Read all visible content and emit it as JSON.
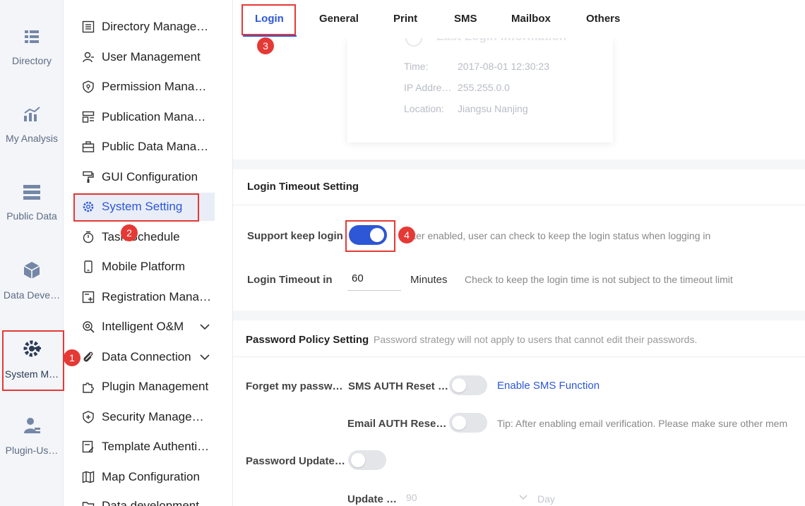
{
  "rail": [
    {
      "label": "Directory",
      "icon": "directory-icon"
    },
    {
      "label": "My Analysis",
      "icon": "analysis-chart-icon"
    },
    {
      "label": "Public Data",
      "icon": "public-data-icon"
    },
    {
      "label": "Data Deve…",
      "icon": "data-dev-cube-icon"
    },
    {
      "label": "System M…",
      "icon": "system-gear-icon",
      "active": true
    },
    {
      "label": "Plugin-Us…",
      "icon": "plugin-user-icon"
    }
  ],
  "menu": [
    {
      "label": "Directory Manage…",
      "icon": "list-icon"
    },
    {
      "label": "User Management",
      "icon": "user-icon"
    },
    {
      "label": "Permission Mana…",
      "icon": "shield-icon"
    },
    {
      "label": "Publication Mana…",
      "icon": "publication-icon"
    },
    {
      "label": "Public Data Mana…",
      "icon": "briefcase-icon"
    },
    {
      "label": "GUI Configuration",
      "icon": "paint-roller-icon"
    },
    {
      "label": "System Setting",
      "icon": "gear-icon",
      "active": true
    },
    {
      "label": "Task Schedule",
      "icon": "stopwatch-icon"
    },
    {
      "label": "Mobile Platform",
      "icon": "mobile-icon"
    },
    {
      "label": "Registration Mana…",
      "icon": "registration-icon"
    },
    {
      "label": "Intelligent O&M",
      "icon": "om-icon",
      "expandable": true
    },
    {
      "label": "Data Connection",
      "icon": "paperclip-icon",
      "expandable": true
    },
    {
      "label": "Plugin Management",
      "icon": "puzzle-icon"
    },
    {
      "label": "Security Manage…",
      "icon": "security-shield-icon"
    },
    {
      "label": "Template Authenti…",
      "icon": "template-icon"
    },
    {
      "label": "Map Configuration",
      "icon": "map-icon"
    },
    {
      "label": "Data development",
      "icon": "folder-icon"
    }
  ],
  "tabs": [
    "Login",
    "General",
    "Print",
    "SMS",
    "Mailbox",
    "Others"
  ],
  "last_login": {
    "title": "Last Login Information",
    "rows": [
      {
        "key": "Time:",
        "value": "2017-08-01 12:30:23"
      },
      {
        "key": "IP Addre…",
        "value": "255.255.0.0"
      },
      {
        "key": "Location:",
        "value": "Jiangsu Nanjing"
      }
    ]
  },
  "login_timeout": {
    "title": "Login Timeout Setting",
    "keep_login_label": "Support keep login",
    "keep_login_on": true,
    "keep_login_hint": "After enabled, user can check to keep the login status when logging in",
    "timeout_label": "Login Timeout in",
    "timeout_value": "60",
    "timeout_unit": "Minutes",
    "timeout_hint": "Check to keep the login time is not subject to the timeout limit"
  },
  "password_policy": {
    "title": "Password Policy Setting",
    "subtitle": "Password strategy will not apply to users that cannot edit their passwords.",
    "forget_label": "Forget my passw…",
    "sms_label": "SMS AUTH Reset …",
    "sms_on": false,
    "sms_link": "Enable SMS Function",
    "email_label": "Email AUTH Rese…",
    "email_on": false,
    "email_hint": "Tip: After enabling email verification. Please make sure other mem",
    "update_label": "Password Update…",
    "update_on": false,
    "update_cycle_label": "Update …",
    "update_cycle_value": "90",
    "update_cycle_unit": "Day"
  },
  "callouts": [
    "1",
    "2",
    "3",
    "4"
  ],
  "colors": {
    "accent": "#2d57d6",
    "callout": "#e53935"
  }
}
